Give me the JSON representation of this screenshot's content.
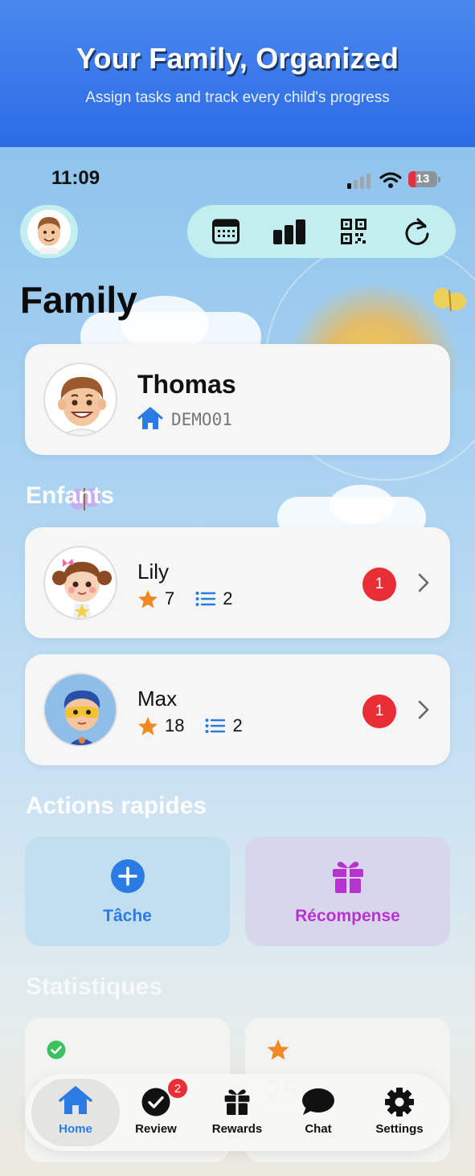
{
  "banner": {
    "title": "Your Family, Organized",
    "subtitle": "Assign tasks and track every child's progress"
  },
  "status_bar": {
    "time": "11:09",
    "battery": "13"
  },
  "toolbar": {
    "icons": [
      "calendar-icon",
      "bar-chart-icon",
      "qr-code-icon",
      "refresh-icon"
    ]
  },
  "page": {
    "title": "Family"
  },
  "parent": {
    "name": "Thomas",
    "code": "DEMO01"
  },
  "children_section": {
    "title": "Enfants"
  },
  "children": [
    {
      "name": "Lily",
      "stars": "7",
      "tasks": "2",
      "badge": "1"
    },
    {
      "name": "Max",
      "stars": "18",
      "tasks": "2",
      "badge": "1"
    }
  ],
  "quick_actions": {
    "title": "Actions rapides",
    "task_label": "Tâche",
    "reward_label": "Récompense"
  },
  "stats": {
    "title": "Statistiques",
    "stars_value": "25"
  },
  "tabs": {
    "home": "Home",
    "review": "Review",
    "review_badge": "2",
    "rewards": "Rewards",
    "chat": "Chat",
    "settings": "Settings"
  },
  "colors": {
    "accent_blue": "#2a7be4",
    "reward_purple": "#b833cf",
    "badge_red": "#ea2e36",
    "star_orange": "#f08a24"
  }
}
